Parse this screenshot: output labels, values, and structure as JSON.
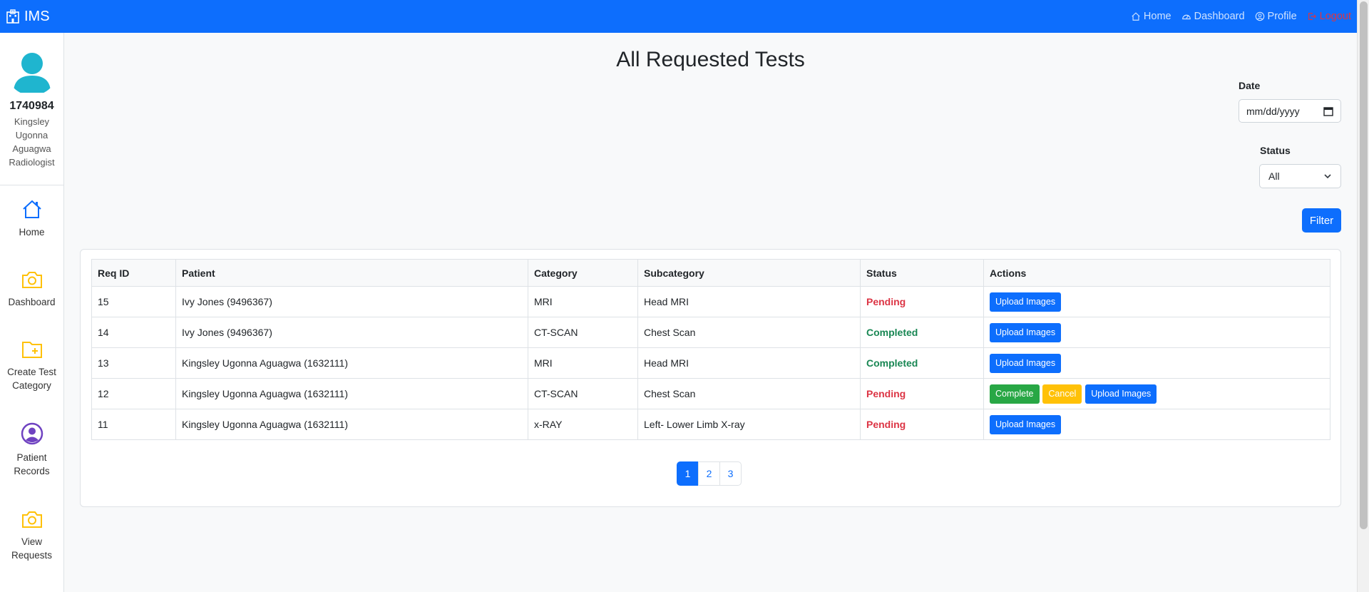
{
  "navbar": {
    "brand": "IMS",
    "links": [
      {
        "label": "Home",
        "icon": "house-icon"
      },
      {
        "label": "Dashboard",
        "icon": "speedometer-icon"
      },
      {
        "label": "Profile",
        "icon": "person-circle-icon"
      },
      {
        "label": "Logout",
        "icon": "logout-icon"
      }
    ]
  },
  "user": {
    "id": "1740984",
    "name": "Kingsley Ugonna Aguagwa",
    "role": "Radiologist"
  },
  "sidebar": {
    "items": [
      {
        "label": "Home",
        "icon": "house-icon"
      },
      {
        "label": "Dashboard",
        "icon": "camera-icon"
      },
      {
        "label": "Create Test Category",
        "icon": "folder-plus-icon"
      },
      {
        "label": "Patient Records",
        "icon": "person-circle-icon"
      },
      {
        "label": "View Requests",
        "icon": "camera-icon"
      }
    ]
  },
  "main": {
    "title": "All Requested Tests"
  },
  "filters": {
    "date_label": "Date",
    "date_placeholder": "mm/dd/yyyy",
    "status_label": "Status",
    "status_value": "All",
    "filter_button": "Filter"
  },
  "table": {
    "headers": [
      "Req ID",
      "Patient",
      "Category",
      "Subcategory",
      "Status",
      "Actions"
    ],
    "rows": [
      {
        "id": "15",
        "patient": "Ivy Jones (9496367)",
        "category": "MRI",
        "subcategory": "Head MRI",
        "status": "Pending",
        "actions": [
          "Upload Images"
        ]
      },
      {
        "id": "14",
        "patient": "Ivy Jones (9496367)",
        "category": "CT-SCAN",
        "subcategory": "Chest Scan",
        "status": "Completed",
        "actions": [
          "Upload Images"
        ]
      },
      {
        "id": "13",
        "patient": "Kingsley Ugonna Aguagwa (1632111)",
        "category": "MRI",
        "subcategory": "Head MRI",
        "status": "Completed",
        "actions": [
          "Upload Images"
        ]
      },
      {
        "id": "12",
        "patient": "Kingsley Ugonna Aguagwa (1632111)",
        "category": "CT-SCAN",
        "subcategory": "Chest Scan",
        "status": "Pending",
        "actions": [
          "Complete",
          "Cancel",
          "Upload Images"
        ]
      },
      {
        "id": "11",
        "patient": "Kingsley Ugonna Aguagwa (1632111)",
        "category": "x-RAY",
        "subcategory": "Left- Lower Limb X-ray",
        "status": "Pending",
        "actions": [
          "Upload Images"
        ]
      }
    ]
  },
  "pagination": {
    "pages": [
      "1",
      "2",
      "3"
    ],
    "current": "1"
  },
  "colors": {
    "primary": "#0d6efd",
    "danger": "#dc3545",
    "success": "#198754",
    "warning": "#ffc107",
    "icon_blue": "#0d6efd",
    "icon_orange": "#ffc107",
    "icon_purple": "#6f42c1",
    "avatar_teal": "#1fb5cf"
  }
}
